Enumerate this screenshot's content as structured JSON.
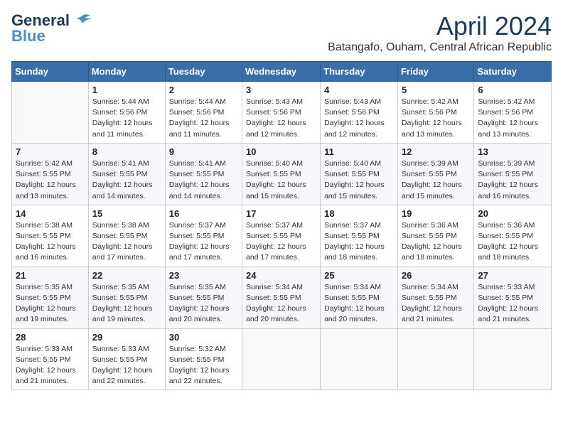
{
  "header": {
    "logo_line1": "General",
    "logo_line2": "Blue",
    "month": "April 2024",
    "location": "Batangafo, Ouham, Central African Republic"
  },
  "days_of_week": [
    "Sunday",
    "Monday",
    "Tuesday",
    "Wednesday",
    "Thursday",
    "Friday",
    "Saturday"
  ],
  "weeks": [
    [
      {
        "day": "",
        "info": ""
      },
      {
        "day": "1",
        "info": "Sunrise: 5:44 AM\nSunset: 5:56 PM\nDaylight: 12 hours\nand 11 minutes."
      },
      {
        "day": "2",
        "info": "Sunrise: 5:44 AM\nSunset: 5:56 PM\nDaylight: 12 hours\nand 11 minutes."
      },
      {
        "day": "3",
        "info": "Sunrise: 5:43 AM\nSunset: 5:56 PM\nDaylight: 12 hours\nand 12 minutes."
      },
      {
        "day": "4",
        "info": "Sunrise: 5:43 AM\nSunset: 5:56 PM\nDaylight: 12 hours\nand 12 minutes."
      },
      {
        "day": "5",
        "info": "Sunrise: 5:42 AM\nSunset: 5:56 PM\nDaylight: 12 hours\nand 13 minutes."
      },
      {
        "day": "6",
        "info": "Sunrise: 5:42 AM\nSunset: 5:56 PM\nDaylight: 12 hours\nand 13 minutes."
      }
    ],
    [
      {
        "day": "7",
        "info": "Sunrise: 5:42 AM\nSunset: 5:55 PM\nDaylight: 12 hours\nand 13 minutes."
      },
      {
        "day": "8",
        "info": "Sunrise: 5:41 AM\nSunset: 5:55 PM\nDaylight: 12 hours\nand 14 minutes."
      },
      {
        "day": "9",
        "info": "Sunrise: 5:41 AM\nSunset: 5:55 PM\nDaylight: 12 hours\nand 14 minutes."
      },
      {
        "day": "10",
        "info": "Sunrise: 5:40 AM\nSunset: 5:55 PM\nDaylight: 12 hours\nand 15 minutes."
      },
      {
        "day": "11",
        "info": "Sunrise: 5:40 AM\nSunset: 5:55 PM\nDaylight: 12 hours\nand 15 minutes."
      },
      {
        "day": "12",
        "info": "Sunrise: 5:39 AM\nSunset: 5:55 PM\nDaylight: 12 hours\nand 15 minutes."
      },
      {
        "day": "13",
        "info": "Sunrise: 5:39 AM\nSunset: 5:55 PM\nDaylight: 12 hours\nand 16 minutes."
      }
    ],
    [
      {
        "day": "14",
        "info": "Sunrise: 5:38 AM\nSunset: 5:55 PM\nDaylight: 12 hours\nand 16 minutes."
      },
      {
        "day": "15",
        "info": "Sunrise: 5:38 AM\nSunset: 5:55 PM\nDaylight: 12 hours\nand 17 minutes."
      },
      {
        "day": "16",
        "info": "Sunrise: 5:37 AM\nSunset: 5:55 PM\nDaylight: 12 hours\nand 17 minutes."
      },
      {
        "day": "17",
        "info": "Sunrise: 5:37 AM\nSunset: 5:55 PM\nDaylight: 12 hours\nand 17 minutes."
      },
      {
        "day": "18",
        "info": "Sunrise: 5:37 AM\nSunset: 5:55 PM\nDaylight: 12 hours\nand 18 minutes."
      },
      {
        "day": "19",
        "info": "Sunrise: 5:36 AM\nSunset: 5:55 PM\nDaylight: 12 hours\nand 18 minutes."
      },
      {
        "day": "20",
        "info": "Sunrise: 5:36 AM\nSunset: 5:55 PM\nDaylight: 12 hours\nand 18 minutes."
      }
    ],
    [
      {
        "day": "21",
        "info": "Sunrise: 5:35 AM\nSunset: 5:55 PM\nDaylight: 12 hours\nand 19 minutes."
      },
      {
        "day": "22",
        "info": "Sunrise: 5:35 AM\nSunset: 5:55 PM\nDaylight: 12 hours\nand 19 minutes."
      },
      {
        "day": "23",
        "info": "Sunrise: 5:35 AM\nSunset: 5:55 PM\nDaylight: 12 hours\nand 20 minutes."
      },
      {
        "day": "24",
        "info": "Sunrise: 5:34 AM\nSunset: 5:55 PM\nDaylight: 12 hours\nand 20 minutes."
      },
      {
        "day": "25",
        "info": "Sunrise: 5:34 AM\nSunset: 5:55 PM\nDaylight: 12 hours\nand 20 minutes."
      },
      {
        "day": "26",
        "info": "Sunrise: 5:34 AM\nSunset: 5:55 PM\nDaylight: 12 hours\nand 21 minutes."
      },
      {
        "day": "27",
        "info": "Sunrise: 5:33 AM\nSunset: 5:55 PM\nDaylight: 12 hours\nand 21 minutes."
      }
    ],
    [
      {
        "day": "28",
        "info": "Sunrise: 5:33 AM\nSunset: 5:55 PM\nDaylight: 12 hours\nand 21 minutes."
      },
      {
        "day": "29",
        "info": "Sunrise: 5:33 AM\nSunset: 5:55 PM\nDaylight: 12 hours\nand 22 minutes."
      },
      {
        "day": "30",
        "info": "Sunrise: 5:32 AM\nSunset: 5:55 PM\nDaylight: 12 hours\nand 22 minutes."
      },
      {
        "day": "",
        "info": ""
      },
      {
        "day": "",
        "info": ""
      },
      {
        "day": "",
        "info": ""
      },
      {
        "day": "",
        "info": ""
      }
    ]
  ]
}
